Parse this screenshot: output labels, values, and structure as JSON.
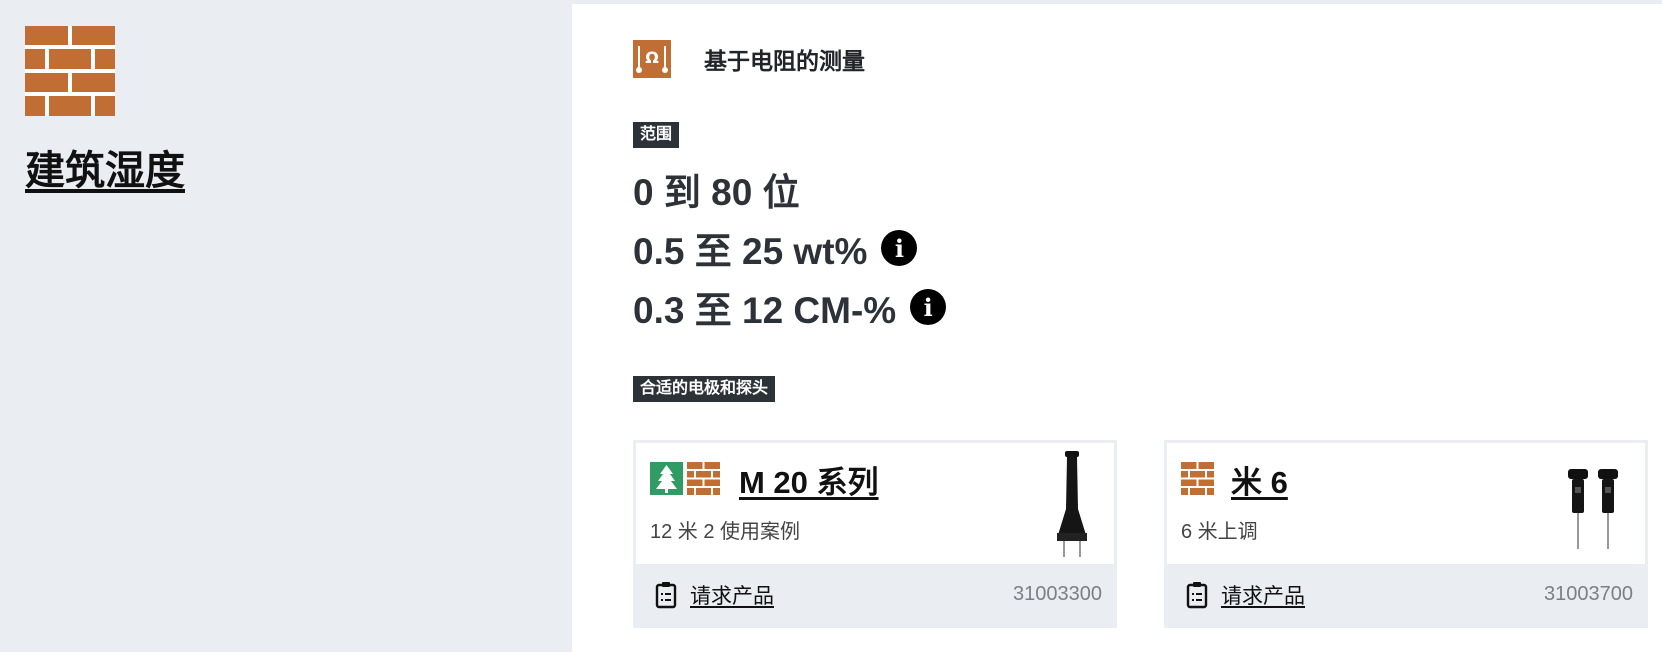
{
  "category": {
    "title": "建筑湿度",
    "icon": "brick-wall-icon",
    "icon_color": "#c06e33"
  },
  "method": {
    "title": "基于电阻的测量",
    "icon": "resistance-ohm-icon"
  },
  "range": {
    "tag": "范围",
    "lines": [
      "0 到 80 位",
      "0.5 至 25 wt%",
      "0.3 至 12 CM-%"
    ]
  },
  "electrodes": {
    "tag": "合适的电极和探头",
    "cards": [
      {
        "title": "M 20 系列",
        "subtitle": "12 米  2 使用案例",
        "icons": [
          "tree-icon",
          "brick-wall-icon"
        ],
        "request_label": "请求产品",
        "article_no": "31003300"
      },
      {
        "title": "米 6",
        "subtitle": "6 米上调",
        "icons": [
          "brick-wall-icon"
        ],
        "request_label": "请求产品",
        "article_no": "31003700"
      }
    ]
  },
  "colors": {
    "accent": "#c06e33",
    "wood_green": "#2e9c63",
    "panel_bg": "#eaedf2",
    "tag_bg": "#2c3238"
  }
}
